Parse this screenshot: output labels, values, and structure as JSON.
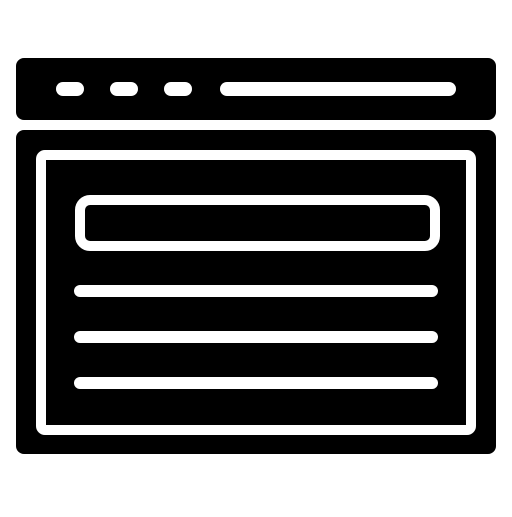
{
  "icon": {
    "name": "browser-window-icon",
    "colors": {
      "foreground": "#000000",
      "background": "#ffffff"
    }
  }
}
